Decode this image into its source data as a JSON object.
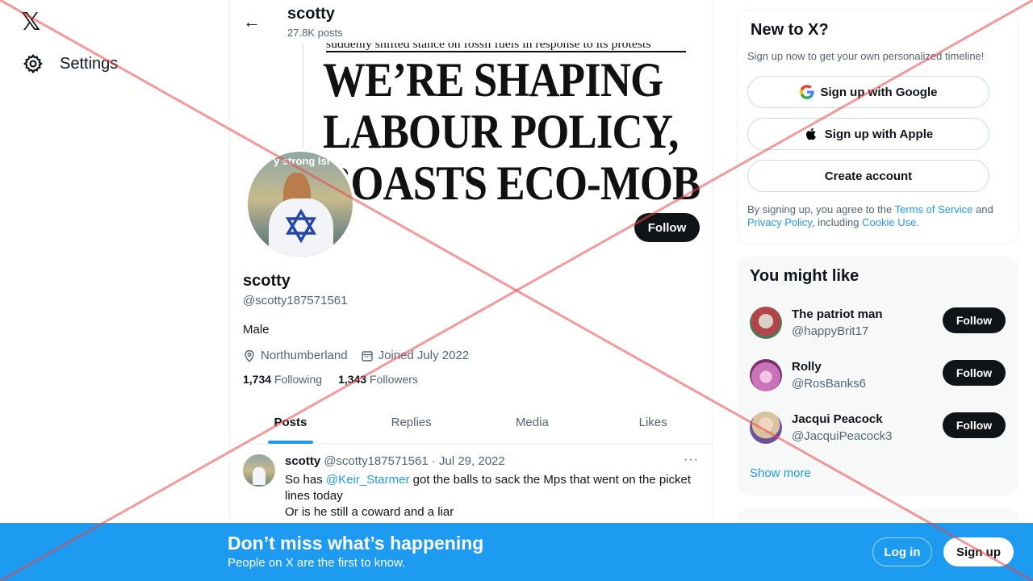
{
  "nav": {
    "logo": "𝕏",
    "settings_label": "Settings"
  },
  "header": {
    "title": "scotty",
    "posts_count": "27.8K posts"
  },
  "banner": {
    "subheadline": "suddenly shifted stance on fossil fuels in response to its protests",
    "headline_line1": "WE’RE SHAPING",
    "headline_line2": "LABOUR POLICY,",
    "headline_line3": "BOASTS ECO-MOB",
    "avatar_overlay_text": "y strong Isr"
  },
  "profile": {
    "follow_label": "Follow",
    "name": "scotty",
    "handle": "@scotty187571561",
    "bio": "Male",
    "location": "Northumberland",
    "joined": "Joined July 2022",
    "following_count": "1,734",
    "following_label": "Following",
    "followers_count": "1,343",
    "followers_label": "Followers"
  },
  "tabs": [
    {
      "label": "Posts",
      "active": true
    },
    {
      "label": "Replies",
      "active": false
    },
    {
      "label": "Media",
      "active": false
    },
    {
      "label": "Likes",
      "active": false
    }
  ],
  "post": {
    "name": "scotty",
    "handle_date": "@scotty187571561 · Jul 29, 2022",
    "more": "···",
    "text_before": "So has ",
    "mention": "@Keir_Starmer",
    "text_after": " got the balls to sack the Mps that went on the picket lines today",
    "line2": "Or is he still a coward and a liar"
  },
  "signup_card": {
    "title": "New to X?",
    "subtitle": "Sign up now to get your own personalized timeline!",
    "google_label": "Sign up with Google",
    "apple_label": "Sign up with Apple",
    "create_label": "Create account",
    "legal_1": "By signing up, you agree to the ",
    "terms": "Terms of Service",
    "legal_2": " and ",
    "privacy": "Privacy Policy",
    "legal_3": ", including ",
    "cookie": "Cookie Use",
    "legal_4": "."
  },
  "who_to_follow": {
    "title": "You might like",
    "follow_label": "Follow",
    "show_more": "Show more",
    "users": [
      {
        "name": "The patriot man",
        "handle": "@happyBrit17",
        "avatar_color": "#b5444a"
      },
      {
        "name": "Rolly",
        "handle": "@RosBanks6",
        "avatar_color": "#c974b8"
      },
      {
        "name": "Jacqui Peacock",
        "handle": "@JacquiPeacock3",
        "avatar_color": "#8a6b57"
      }
    ]
  },
  "bottom_bar": {
    "title": "Don’t miss what’s happening",
    "subtitle": "People on X are the first to know.",
    "login_label": "Log in",
    "signup_label": "Sign up"
  },
  "colors": {
    "accent": "#1d9bf0",
    "text": "#0f1419",
    "muted": "#536471",
    "overlay_x": "#e8464a"
  }
}
